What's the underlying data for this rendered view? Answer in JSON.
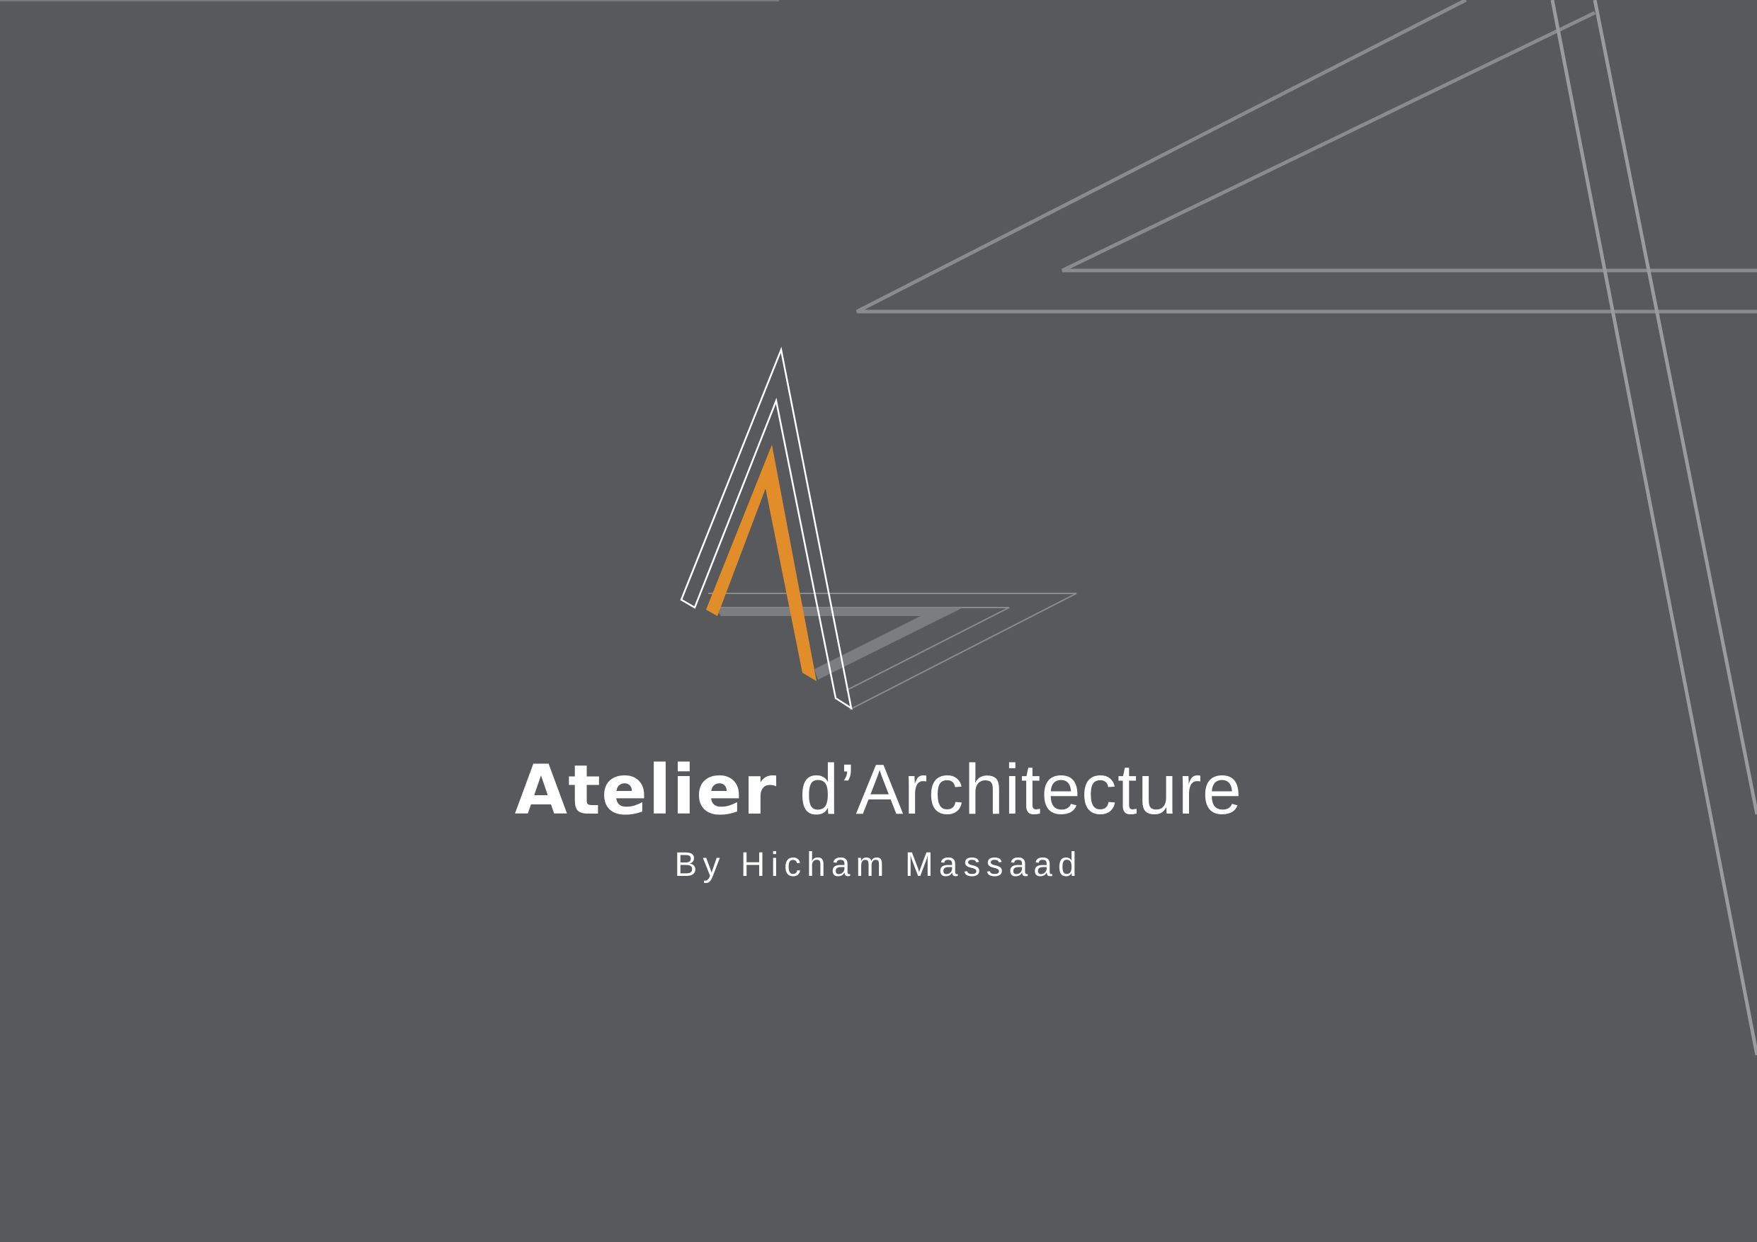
{
  "page": {
    "background_color": "#58595d",
    "accent_color": "#e18e2a",
    "line_color": "#8a8b8e"
  },
  "brand": {
    "name_bold": "Atelier",
    "name_light": "d’Architecture",
    "byline": "By Hicham Massaad"
  },
  "graphics": {
    "logo_icon": "architecture-a-logo-icon",
    "decoration": "geometric-line-decoration"
  }
}
